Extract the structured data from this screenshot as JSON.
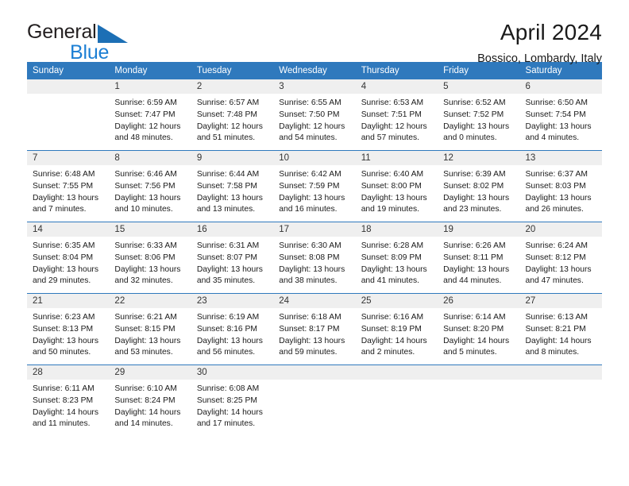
{
  "brand": {
    "name_top": "General",
    "name_bottom": "Blue",
    "triangle_color": "#1c6fb5"
  },
  "header": {
    "title": "April 2024",
    "subtitle": "Bossico, Lombardy, Italy"
  },
  "theme": {
    "header_blue": "#2f79bd",
    "daynum_band": "#efefef",
    "text": "#1a1a1a"
  },
  "weekdays": [
    "Sunday",
    "Monday",
    "Tuesday",
    "Wednesday",
    "Thursday",
    "Friday",
    "Saturday"
  ],
  "labels": {
    "sunrise_prefix": "Sunrise:",
    "sunset_prefix": "Sunset:",
    "daylight_prefix": "Daylight:"
  },
  "weeks": [
    [
      {
        "day": "",
        "empty": true,
        "line1": "",
        "line2": "",
        "line3": "",
        "line4": ""
      },
      {
        "day": "1",
        "line1": "Sunrise: 6:59 AM",
        "line2": "Sunset: 7:47 PM",
        "line3": "Daylight: 12 hours",
        "line4": "and 48 minutes."
      },
      {
        "day": "2",
        "line1": "Sunrise: 6:57 AM",
        "line2": "Sunset: 7:48 PM",
        "line3": "Daylight: 12 hours",
        "line4": "and 51 minutes."
      },
      {
        "day": "3",
        "line1": "Sunrise: 6:55 AM",
        "line2": "Sunset: 7:50 PM",
        "line3": "Daylight: 12 hours",
        "line4": "and 54 minutes."
      },
      {
        "day": "4",
        "line1": "Sunrise: 6:53 AM",
        "line2": "Sunset: 7:51 PM",
        "line3": "Daylight: 12 hours",
        "line4": "and 57 minutes."
      },
      {
        "day": "5",
        "line1": "Sunrise: 6:52 AM",
        "line2": "Sunset: 7:52 PM",
        "line3": "Daylight: 13 hours",
        "line4": "and 0 minutes."
      },
      {
        "day": "6",
        "line1": "Sunrise: 6:50 AM",
        "line2": "Sunset: 7:54 PM",
        "line3": "Daylight: 13 hours",
        "line4": "and 4 minutes."
      }
    ],
    [
      {
        "day": "7",
        "line1": "Sunrise: 6:48 AM",
        "line2": "Sunset: 7:55 PM",
        "line3": "Daylight: 13 hours",
        "line4": "and 7 minutes."
      },
      {
        "day": "8",
        "line1": "Sunrise: 6:46 AM",
        "line2": "Sunset: 7:56 PM",
        "line3": "Daylight: 13 hours",
        "line4": "and 10 minutes."
      },
      {
        "day": "9",
        "line1": "Sunrise: 6:44 AM",
        "line2": "Sunset: 7:58 PM",
        "line3": "Daylight: 13 hours",
        "line4": "and 13 minutes."
      },
      {
        "day": "10",
        "line1": "Sunrise: 6:42 AM",
        "line2": "Sunset: 7:59 PM",
        "line3": "Daylight: 13 hours",
        "line4": "and 16 minutes."
      },
      {
        "day": "11",
        "line1": "Sunrise: 6:40 AM",
        "line2": "Sunset: 8:00 PM",
        "line3": "Daylight: 13 hours",
        "line4": "and 19 minutes."
      },
      {
        "day": "12",
        "line1": "Sunrise: 6:39 AM",
        "line2": "Sunset: 8:02 PM",
        "line3": "Daylight: 13 hours",
        "line4": "and 23 minutes."
      },
      {
        "day": "13",
        "line1": "Sunrise: 6:37 AM",
        "line2": "Sunset: 8:03 PM",
        "line3": "Daylight: 13 hours",
        "line4": "and 26 minutes."
      }
    ],
    [
      {
        "day": "14",
        "line1": "Sunrise: 6:35 AM",
        "line2": "Sunset: 8:04 PM",
        "line3": "Daylight: 13 hours",
        "line4": "and 29 minutes."
      },
      {
        "day": "15",
        "line1": "Sunrise: 6:33 AM",
        "line2": "Sunset: 8:06 PM",
        "line3": "Daylight: 13 hours",
        "line4": "and 32 minutes."
      },
      {
        "day": "16",
        "line1": "Sunrise: 6:31 AM",
        "line2": "Sunset: 8:07 PM",
        "line3": "Daylight: 13 hours",
        "line4": "and 35 minutes."
      },
      {
        "day": "17",
        "line1": "Sunrise: 6:30 AM",
        "line2": "Sunset: 8:08 PM",
        "line3": "Daylight: 13 hours",
        "line4": "and 38 minutes."
      },
      {
        "day": "18",
        "line1": "Sunrise: 6:28 AM",
        "line2": "Sunset: 8:09 PM",
        "line3": "Daylight: 13 hours",
        "line4": "and 41 minutes."
      },
      {
        "day": "19",
        "line1": "Sunrise: 6:26 AM",
        "line2": "Sunset: 8:11 PM",
        "line3": "Daylight: 13 hours",
        "line4": "and 44 minutes."
      },
      {
        "day": "20",
        "line1": "Sunrise: 6:24 AM",
        "line2": "Sunset: 8:12 PM",
        "line3": "Daylight: 13 hours",
        "line4": "and 47 minutes."
      }
    ],
    [
      {
        "day": "21",
        "line1": "Sunrise: 6:23 AM",
        "line2": "Sunset: 8:13 PM",
        "line3": "Daylight: 13 hours",
        "line4": "and 50 minutes."
      },
      {
        "day": "22",
        "line1": "Sunrise: 6:21 AM",
        "line2": "Sunset: 8:15 PM",
        "line3": "Daylight: 13 hours",
        "line4": "and 53 minutes."
      },
      {
        "day": "23",
        "line1": "Sunrise: 6:19 AM",
        "line2": "Sunset: 8:16 PM",
        "line3": "Daylight: 13 hours",
        "line4": "and 56 minutes."
      },
      {
        "day": "24",
        "line1": "Sunrise: 6:18 AM",
        "line2": "Sunset: 8:17 PM",
        "line3": "Daylight: 13 hours",
        "line4": "and 59 minutes."
      },
      {
        "day": "25",
        "line1": "Sunrise: 6:16 AM",
        "line2": "Sunset: 8:19 PM",
        "line3": "Daylight: 14 hours",
        "line4": "and 2 minutes."
      },
      {
        "day": "26",
        "line1": "Sunrise: 6:14 AM",
        "line2": "Sunset: 8:20 PM",
        "line3": "Daylight: 14 hours",
        "line4": "and 5 minutes."
      },
      {
        "day": "27",
        "line1": "Sunrise: 6:13 AM",
        "line2": "Sunset: 8:21 PM",
        "line3": "Daylight: 14 hours",
        "line4": "and 8 minutes."
      }
    ],
    [
      {
        "day": "28",
        "line1": "Sunrise: 6:11 AM",
        "line2": "Sunset: 8:23 PM",
        "line3": "Daylight: 14 hours",
        "line4": "and 11 minutes."
      },
      {
        "day": "29",
        "line1": "Sunrise: 6:10 AM",
        "line2": "Sunset: 8:24 PM",
        "line3": "Daylight: 14 hours",
        "line4": "and 14 minutes."
      },
      {
        "day": "30",
        "line1": "Sunrise: 6:08 AM",
        "line2": "Sunset: 8:25 PM",
        "line3": "Daylight: 14 hours",
        "line4": "and 17 minutes."
      },
      {
        "day": "",
        "empty": true,
        "line1": "",
        "line2": "",
        "line3": "",
        "line4": ""
      },
      {
        "day": "",
        "empty": true,
        "line1": "",
        "line2": "",
        "line3": "",
        "line4": ""
      },
      {
        "day": "",
        "empty": true,
        "line1": "",
        "line2": "",
        "line3": "",
        "line4": ""
      },
      {
        "day": "",
        "empty": true,
        "line1": "",
        "line2": "",
        "line3": "",
        "line4": ""
      }
    ]
  ]
}
